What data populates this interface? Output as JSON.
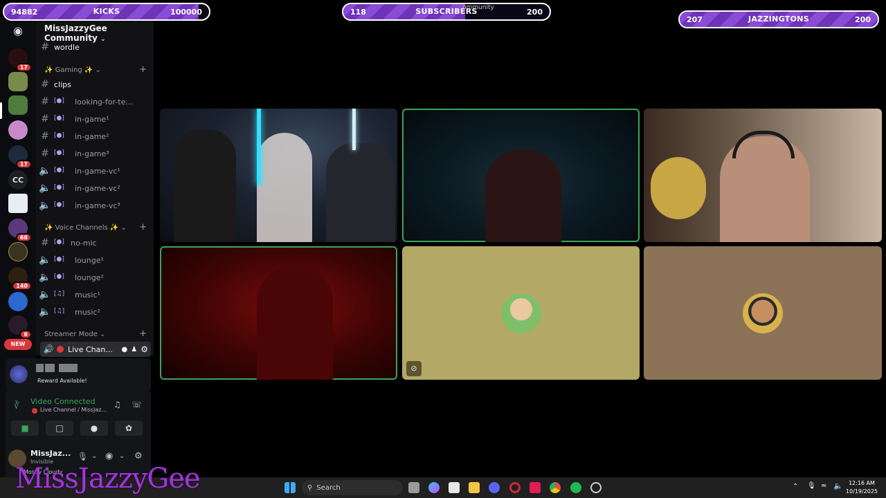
{
  "goals": {
    "kicks": {
      "current": "94882",
      "label": "KICKS",
      "target": "100000",
      "progress": 0.95
    },
    "subscribers": {
      "current": "118",
      "label": "SUBSCRIBERS",
      "target": "200",
      "progress": 0.59
    },
    "jazzingtons": {
      "current": "207",
      "label": "JAZZINGTONS",
      "target": "200",
      "progress": 1.0
    }
  },
  "window": {
    "title_fragment": "ommunity"
  },
  "rail": {
    "badges": [
      "17",
      "17",
      "68",
      "140",
      "6"
    ],
    "cc_label": "CC",
    "new_label": "NEW"
  },
  "server": {
    "name": "MissJazzyGee Community"
  },
  "channels": {
    "wordle": "wordle",
    "gaming_category": "Gaming",
    "clips": "clips",
    "looking": "looking-for-te...",
    "in_game1": "in-game¹",
    "in_game2": "in-game²",
    "in_game3": "in-game³",
    "in_game_vc1": "in-game-vc¹",
    "in_game_vc2": "in-game-vc²",
    "in_game_vc3": "in-game-vc³",
    "voice_category": "Voice Channels",
    "no_mic": "no-mic",
    "lounge1": "lounge¹",
    "lounge2": "lounge²",
    "music1": "music¹",
    "music2": "music²",
    "streamer_category": "Streamer Mode",
    "live_channel": "Live Chan..."
  },
  "reward": {
    "text": "Reward Available!"
  },
  "voice": {
    "status": "Video Connected",
    "channel": "Live Channel / MissJaz..."
  },
  "user": {
    "name": "MissJaz...",
    "status": "Invisible",
    "activity": "Mostly Cloudy"
  },
  "watermark": "MissJazzyGee",
  "taskbar": {
    "search": "Search",
    "time": "12:16 AM",
    "date": "10/19/2025"
  },
  "colors": {
    "accent_purple": "#8a4bd6",
    "speaking_green": "#3ba55c",
    "live_red": "#da373c"
  }
}
